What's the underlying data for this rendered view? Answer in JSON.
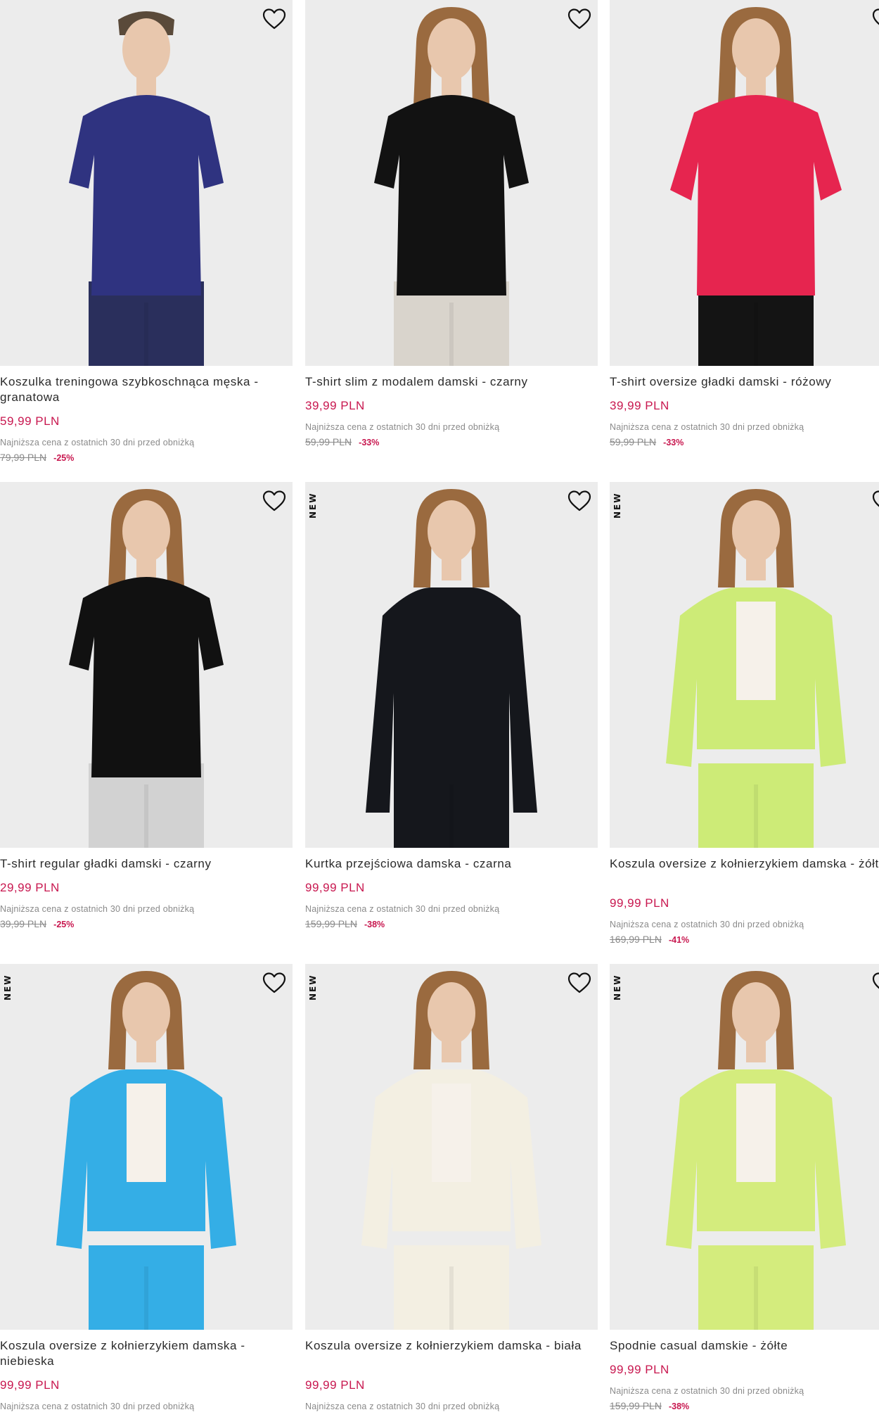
{
  "colors": {
    "price": "#c8174f",
    "muted": "#8a8a8a",
    "image_bg": "#ececec"
  },
  "icons": {
    "favorite": "heart-outline-icon"
  },
  "products": [
    {
      "title": "Koszulka treningowa szybkoschnąca męska - granatowa",
      "price": "59,99 PLN",
      "lowest_note": "Najniższa cena z ostatnich 30 dni przed obniżką",
      "old_price": "79,99 PLN",
      "discount": "-25%",
      "badge": "",
      "garment_color": "#2f3380",
      "bottom_color": "#2a2f5c"
    },
    {
      "title": "T-shirt slim z modalem damski - czarny",
      "price": "39,99 PLN",
      "lowest_note": "Najniższa cena z ostatnich 30 dni przed obniżką",
      "old_price": "59,99 PLN",
      "discount": "-33%",
      "badge": "",
      "garment_color": "#121212",
      "bottom_color": "#d9d4cc"
    },
    {
      "title": "T-shirt oversize gładki damski - różowy",
      "price": "39,99 PLN",
      "lowest_note": "Najniższa cena z ostatnich 30 dni przed obniżką",
      "old_price": "59,99 PLN",
      "discount": "-33%",
      "badge": "",
      "garment_color": "#e6254f",
      "bottom_color": "#141414"
    },
    {
      "title": "T-shirt regular gładki damski - czarny",
      "price": "29,99 PLN",
      "lowest_note": "Najniższa cena z ostatnich 30 dni przed obniżką",
      "old_price": "39,99 PLN",
      "discount": "-25%",
      "badge": "",
      "garment_color": "#111111",
      "bottom_color": "#d2d2d2"
    },
    {
      "title": "Kurtka przejściowa damska - czarna",
      "price": "99,99 PLN",
      "lowest_note": "Najniższa cena z ostatnich 30 dni przed obniżką",
      "old_price": "159,99 PLN",
      "discount": "-38%",
      "badge": "NEW",
      "garment_color": "#15171c",
      "bottom_color": "#15171c"
    },
    {
      "title": "Koszula oversize z kołnierzykiem damska - żółta",
      "price": "99,99 PLN",
      "lowest_note": "Najniższa cena z ostatnich 30 dni przed obniżką",
      "old_price": "169,99 PLN",
      "discount": "-41%",
      "badge": "NEW",
      "garment_color": "#cdeb77",
      "bottom_color": "#cdeb77"
    },
    {
      "title": "Koszula oversize z kołnierzykiem damska - niebieska",
      "price": "99,99 PLN",
      "lowest_note": "Najniższa cena z ostatnich 30 dni przed obniżką",
      "old_price": "",
      "discount": "",
      "badge": "NEW",
      "garment_color": "#34aee6",
      "bottom_color": "#34aee6"
    },
    {
      "title": "Koszula oversize z kołnierzykiem damska - biała",
      "price": "99,99 PLN",
      "lowest_note": "Najniższa cena z ostatnich 30 dni przed obniżką",
      "old_price": "",
      "discount": "",
      "badge": "NEW",
      "garment_color": "#f3efe2",
      "bottom_color": "#f3efe2"
    },
    {
      "title": "Spodnie casual damskie - żółte",
      "price": "99,99 PLN",
      "lowest_note": "Najniższa cena z ostatnich 30 dni przed obniżką",
      "old_price": "159,99 PLN",
      "discount": "-38%",
      "badge": "NEW",
      "garment_color": "#d4ec7d",
      "bottom_color": "#d4ec7d"
    }
  ]
}
